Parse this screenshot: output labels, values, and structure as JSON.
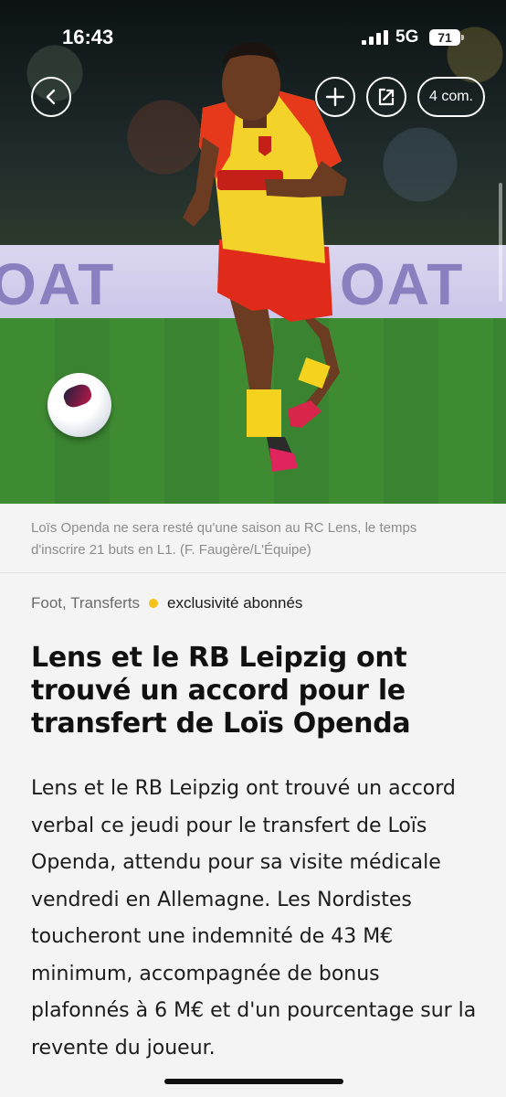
{
  "status_bar": {
    "time": "16:43",
    "network": "5G",
    "battery": "71"
  },
  "toolbar": {
    "back_icon": "chevron-left-icon",
    "add_icon": "plus-icon",
    "share_icon": "share-icon",
    "comments_label": "4 com."
  },
  "photo": {
    "board_text_left": "OAT",
    "board_text_right": "OAT",
    "caption": "Loïs Openda ne sera resté qu'une saison au RC Lens, le temps d'inscrire 21 buts en L1. (F. Faugère/L'Équipe)"
  },
  "article": {
    "category": "Foot, Transferts",
    "premium_label": "exclusivité abonnés",
    "premium_dot_color": "#f2c318",
    "title": "Lens et le RB Leipzig ont trouvé un accord pour le transfert de Loïs Openda",
    "lead": "Lens et le RB Leipzig ont trouvé un accord verbal ce jeudi pour le transfert de Loïs Openda, attendu pour sa visite médicale vendredi en Allemagne. Les Nordistes toucheront une indemnité de 43 M€ minimum, accompagnée de bonus plafonnés à 6 M€ et d'un pourcentage sur la revente du joueur."
  }
}
